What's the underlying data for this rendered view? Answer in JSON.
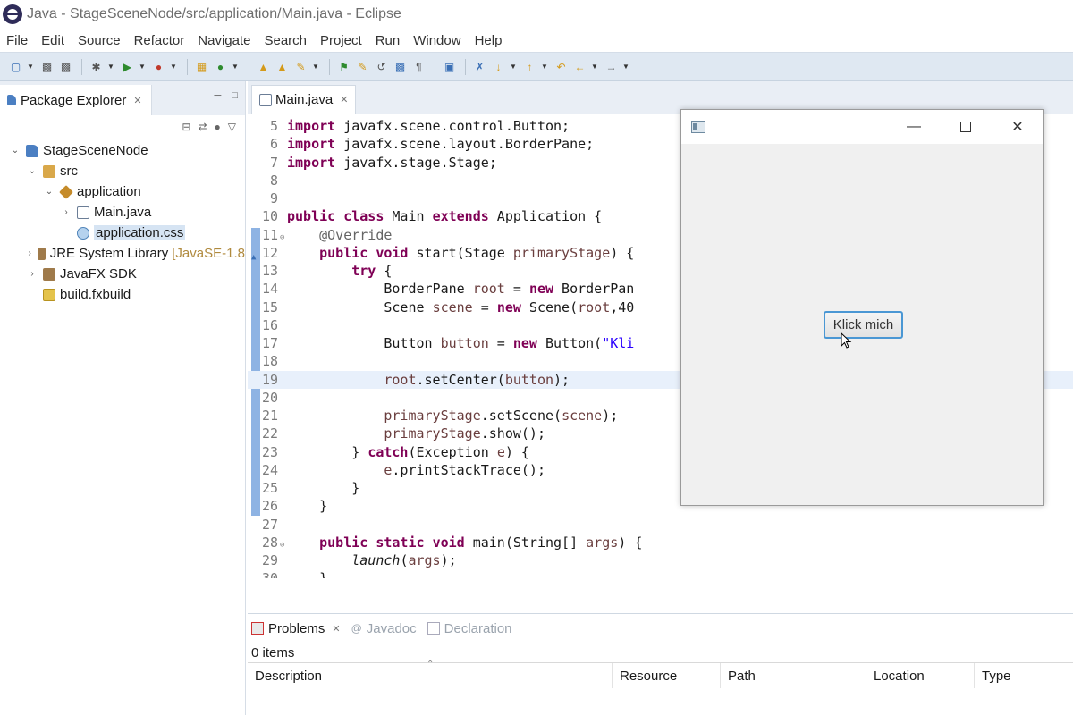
{
  "window": {
    "title": "Java - StageSceneNode/src/application/Main.java - Eclipse"
  },
  "menu": [
    "File",
    "Edit",
    "Source",
    "Refactor",
    "Navigate",
    "Search",
    "Project",
    "Run",
    "Window",
    "Help"
  ],
  "package_explorer": {
    "tab_label": "Package Explorer",
    "tree": [
      {
        "label": "StageSceneNode",
        "expanded": true
      },
      {
        "label": "src",
        "expanded": true
      },
      {
        "label": "application",
        "expanded": true
      },
      {
        "label": "Main.java",
        "expanded": false
      },
      {
        "label": "application.css"
      },
      {
        "label": "JRE System Library",
        "suffix": "[JavaSE-1.8"
      },
      {
        "label": "JavaFX SDK"
      },
      {
        "label": "build.fxbuild"
      }
    ]
  },
  "editor": {
    "tab_label": "Main.java",
    "lines": [
      {
        "n": "5",
        "text": "import javafx.scene.control.Button;"
      },
      {
        "n": "6",
        "text": "import javafx.scene.layout.BorderPane;"
      },
      {
        "n": "7",
        "text": "import javafx.stage.Stage;"
      },
      {
        "n": "8",
        "text": ""
      },
      {
        "n": "9",
        "text": ""
      },
      {
        "n": "10",
        "text": "public class Main extends Application {"
      },
      {
        "n": "11",
        "text": "    @Override"
      },
      {
        "n": "12",
        "text": "    public void start(Stage primaryStage) {"
      },
      {
        "n": "13",
        "text": "        try {"
      },
      {
        "n": "14",
        "text": "            BorderPane root = new BorderPan"
      },
      {
        "n": "15",
        "text": "            Scene scene = new Scene(root,40"
      },
      {
        "n": "16",
        "text": ""
      },
      {
        "n": "17",
        "text": "            Button button = new Button(\"Kli"
      },
      {
        "n": "18",
        "text": ""
      },
      {
        "n": "19",
        "text": "            root.setCenter(button);"
      },
      {
        "n": "20",
        "text": ""
      },
      {
        "n": "21",
        "text": "            primaryStage.setScene(scene);"
      },
      {
        "n": "22",
        "text": "            primaryStage.show();"
      },
      {
        "n": "23",
        "text": "        } catch(Exception e) {"
      },
      {
        "n": "24",
        "text": "            e.printStackTrace();"
      },
      {
        "n": "25",
        "text": "        }"
      },
      {
        "n": "26",
        "text": "    }"
      },
      {
        "n": "27",
        "text": ""
      },
      {
        "n": "28",
        "text": "    public static void main(String[] args) {"
      },
      {
        "n": "29",
        "text": "        launch(args);"
      },
      {
        "n": "30",
        "text": "    }"
      }
    ]
  },
  "bottom_panel": {
    "tabs": [
      "Problems",
      "Javadoc",
      "Declaration"
    ],
    "count_label": "0 items",
    "columns": [
      "Description",
      "Resource",
      "Path",
      "Location",
      "Type"
    ]
  },
  "fx_window": {
    "button_label": "Klick mich"
  },
  "colors": {
    "keyword": "#7f0055",
    "string": "#2a00ff",
    "annotation": "#646464",
    "toolbar": "#dfe8f2",
    "current_line": "#e8f0fb",
    "fx_button_border": "#4a97d4"
  }
}
